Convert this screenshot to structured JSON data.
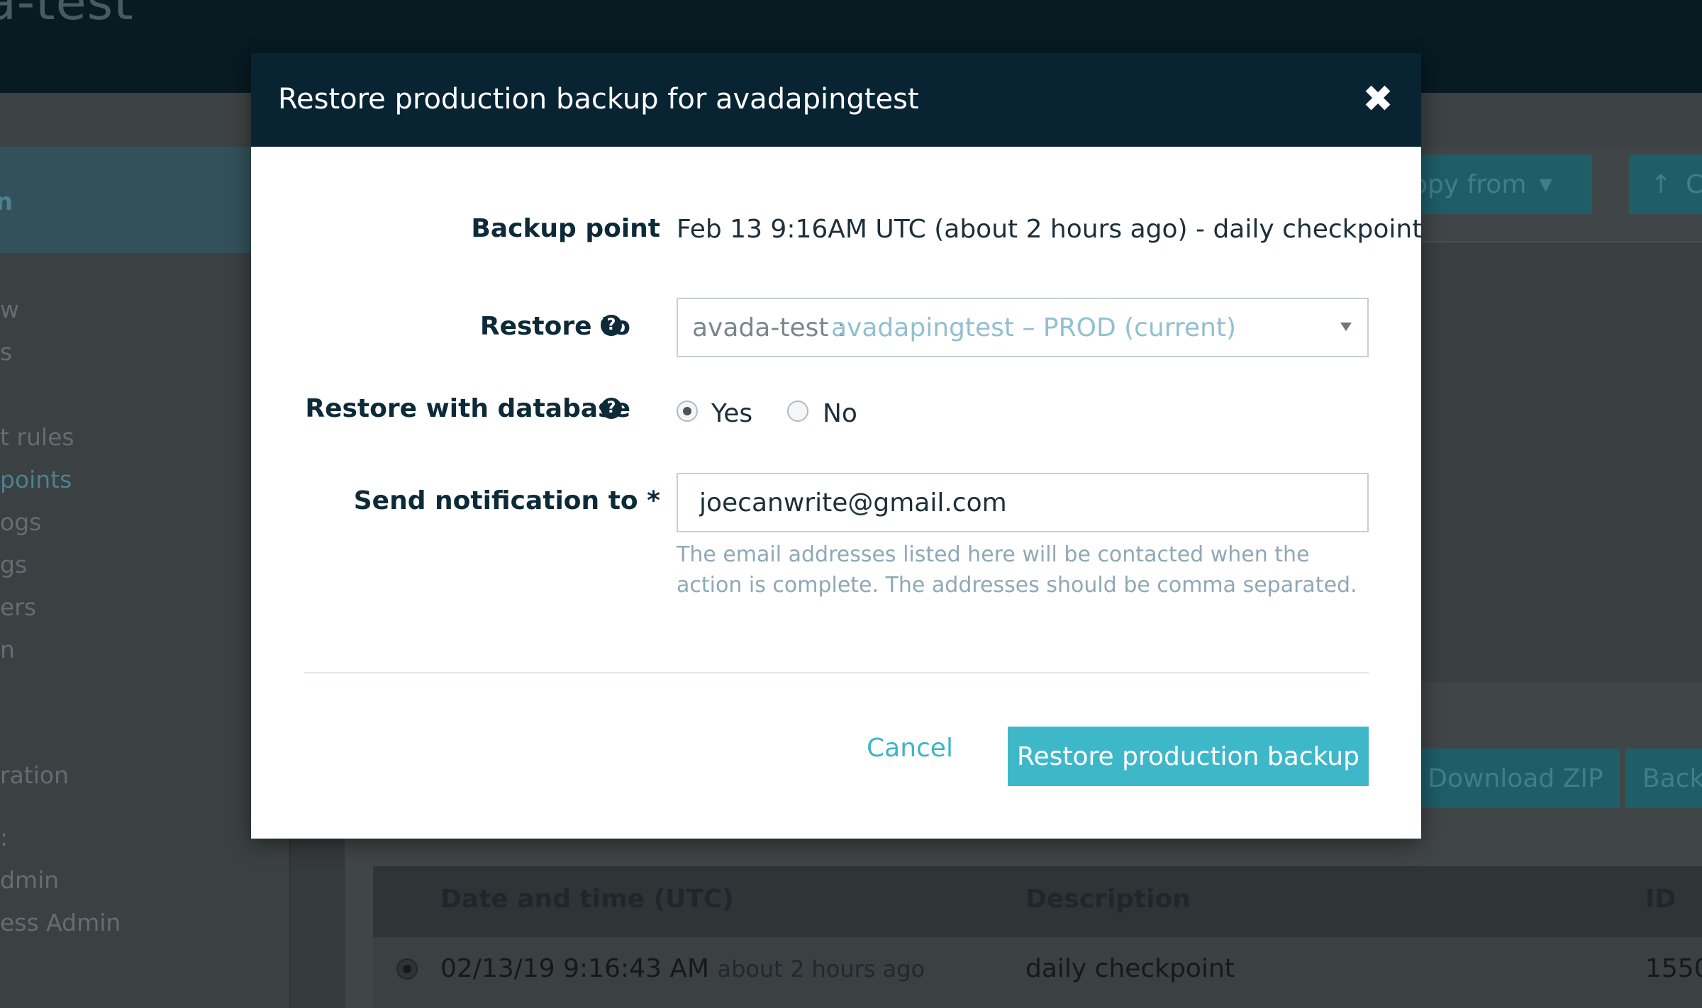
{
  "background": {
    "site_title": "a-test",
    "sidebar_active": "n",
    "nav_items": [
      "w",
      "s",
      "t rules",
      "points",
      "ogs",
      "gs",
      "ers",
      "n",
      "ration",
      ":",
      "dmin",
      "ess Admin"
    ],
    "buttons": {
      "copy_from": "opy from",
      "upload": "C",
      "download_zip": "Download ZIP",
      "back": "Back"
    },
    "table": {
      "headers": [
        "Date and time (UTC)",
        "Description",
        "ID"
      ],
      "row": {
        "datetime": "02/13/19 9:16:43 AM",
        "relative": "about 2 hours ago",
        "description": "daily checkpoint",
        "id": "1550"
      }
    }
  },
  "modal": {
    "title": "Restore production backup for avadapingtest",
    "close_icon": "close-icon",
    "backup_point_label": "Backup point",
    "backup_point_value": "Feb 13 9:16AM UTC (about 2 hours ago) - daily checkpoint",
    "restore_to_label": "Restore to",
    "restore_to_prefix": "avada-test :",
    "restore_to_value": "avadapingtest – PROD (current)",
    "restore_db_label": "Restore with database",
    "restore_db_options": [
      "Yes",
      "No"
    ],
    "restore_db_selected": "Yes",
    "notify_label": "Send notification to *",
    "notify_value": "joecanwrite@gmail.com",
    "notify_hint": "The email addresses listed here will be contacted when the action is complete. The addresses should be comma separated.",
    "cancel_label": "Cancel",
    "submit_label": "Restore production backup"
  },
  "colors": {
    "header": "#082433",
    "accent": "#3eb8c9",
    "label": "#0d2a38",
    "hint": "#8fa8b5"
  }
}
